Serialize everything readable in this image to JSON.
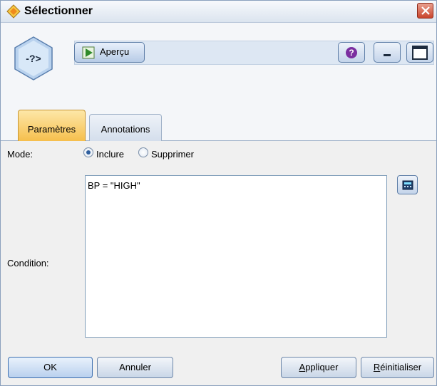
{
  "window": {
    "title": "Sélectionner",
    "title_icon": "select-node-diamond-icon",
    "close_icon": "close-x-icon"
  },
  "toolbar": {
    "node_icon": "select-node-icon",
    "node_icon_text": "-?>",
    "preview_label": "Aperçu",
    "preview_icon": "preview-play-icon",
    "help_icon": "help-question-icon",
    "minimize_icon": "minimize-icon",
    "maximize_icon": "maximize-icon"
  },
  "tabs": [
    {
      "label": "Paramètres",
      "active": true
    },
    {
      "label": "Annotations",
      "active": false
    }
  ],
  "settings": {
    "mode_label": "Mode:",
    "mode_options": [
      {
        "label": "Inclure",
        "selected": true
      },
      {
        "label": "Supprimer",
        "selected": false
      }
    ],
    "condition_label": "Condition:",
    "condition_value": "BP = \"HIGH\"",
    "expression_builder_icon": "expression-builder-icon"
  },
  "buttons": {
    "ok": "OK",
    "cancel": "Annuler",
    "apply_u": "A",
    "apply_rest": "ppliquer",
    "reset_u": "R",
    "reset_rest": "éinitialiser"
  },
  "colors": {
    "active_tab": "#f6bf4d",
    "title_close": "#c9442c",
    "accent_blue": "#3c6fb0"
  }
}
